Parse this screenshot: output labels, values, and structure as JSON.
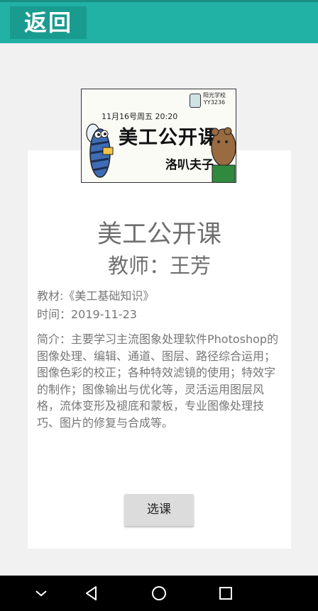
{
  "header": {
    "back_label": "返回"
  },
  "cover": {
    "date_text": "11月16号周五 20:20",
    "badge_line1": "阳光学校",
    "badge_line2": "YY3236",
    "title": "美工公开课",
    "author": "洛叭夫子"
  },
  "course": {
    "title": "美工公开课",
    "teacher": "教师：王芳",
    "textbook": "教材:《美工基础知识》",
    "time": "时间：2019-11-23",
    "intro": "简介：主要学习主流图象处理软件Photoshop的图像处理、编辑、通道、图层、路径综合运用；图像色彩的校正；各种特效滤镜的使用；特效字的制作；图像输出与优化等，灵活运用图层风格，流体变形及褪底和蒙板，专业图像处理技巧、图片的修复与合成等。"
  },
  "actions": {
    "select_label": "选课"
  },
  "colors": {
    "header": "#21b1a5",
    "back_button": "#1a9b90",
    "text_gray": "#6f6f6f"
  },
  "navbar": {
    "icons": [
      "chevron-down-icon",
      "back-triangle-icon",
      "home-circle-icon",
      "recents-square-icon"
    ]
  }
}
